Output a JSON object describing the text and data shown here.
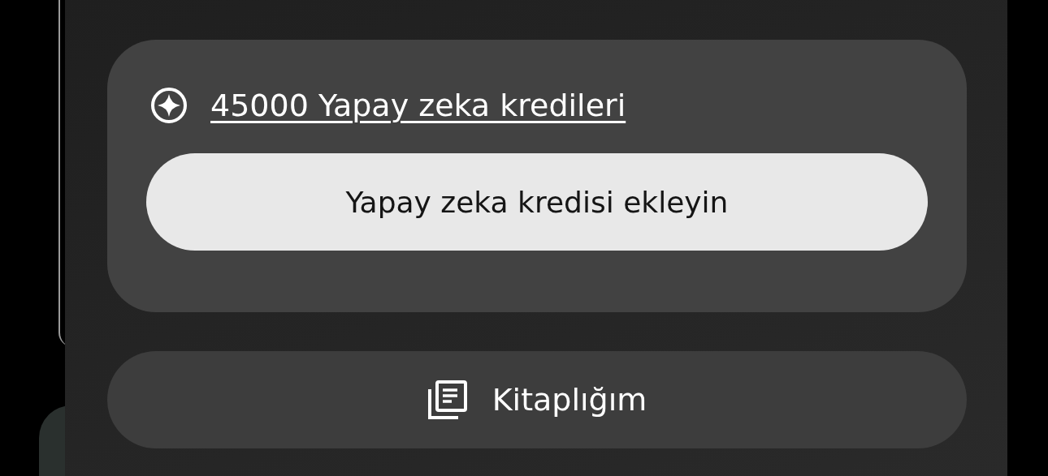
{
  "credits": {
    "link": "45000 Yapay zeka kredileri",
    "button": "Yapay zeka kredisi ekleyin"
  },
  "library_button": {
    "label": "Kitaplığım"
  }
}
